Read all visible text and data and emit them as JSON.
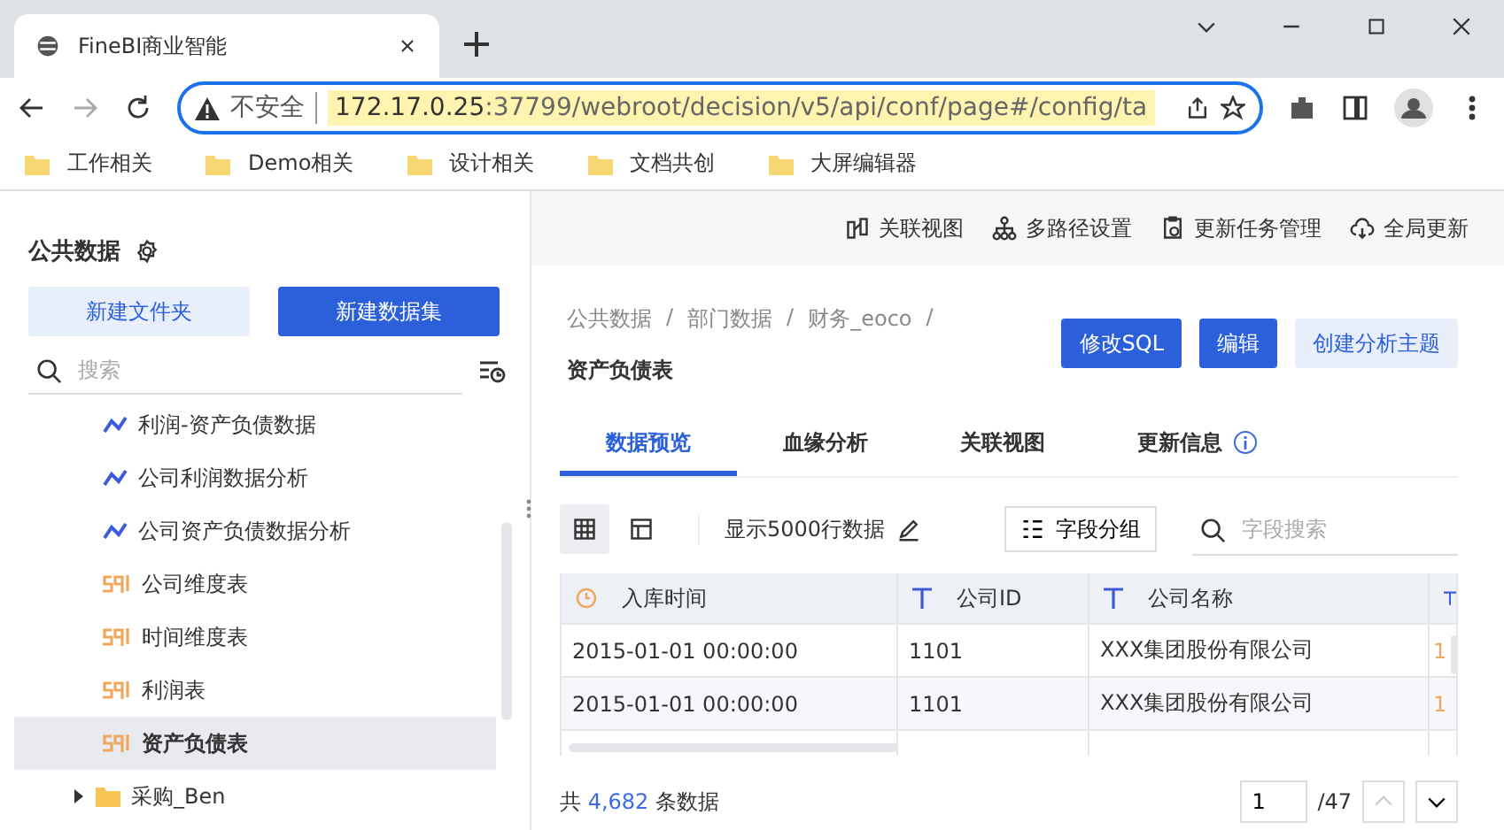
{
  "browser": {
    "tab_title": "FineBI商业智能",
    "security": "不安全",
    "url_host": "172.17.0.25",
    "url_rest": ":37799/webroot/decision/v5/api/conf/page#/config/ta",
    "bookmarks": [
      "工作相关",
      "Demo相关",
      "设计相关",
      "文档共创",
      "大屏编辑器"
    ]
  },
  "sidebar": {
    "title": "公共数据",
    "buttons": [
      {
        "label": "新建文件夹",
        "kind": "secondary"
      },
      {
        "label": "新建数据集",
        "kind": "primary"
      }
    ],
    "search": {
      "placeholder": "搜索"
    },
    "tree": [
      {
        "children": [
          {
            "label": "利润-资产负债数据",
            "kind": "analysis",
            "selected": false
          },
          {
            "label": "公司利润数据分析",
            "kind": "analysis",
            "selected": false
          },
          {
            "label": "公司资产负债数据分析",
            "kind": "analysis",
            "selected": false
          },
          {
            "label": "公司维度表",
            "kind": "sql",
            "selected": false
          },
          {
            "label": "时间维度表",
            "kind": "sql",
            "selected": false
          },
          {
            "label": "利润表",
            "kind": "sql",
            "selected": false
          },
          {
            "label": "资产负债表",
            "kind": "sql",
            "selected": true
          }
        ]
      },
      {
        "label": "采购_Ben",
        "kind": "folder",
        "expanded": false,
        "selected": false
      }
    ]
  },
  "top_actions": [
    {
      "label": "关联视图",
      "kind": "relation"
    },
    {
      "label": "多路径设置",
      "kind": "path"
    },
    {
      "label": "更新任务管理",
      "kind": "task"
    },
    {
      "label": "全局更新",
      "kind": "cloud"
    }
  ],
  "breadcrumb": [
    "公共数据",
    "部门数据",
    "财务_eoco"
  ],
  "dataset_title": "资产负债表",
  "actions": [
    {
      "label": "修改SQL",
      "kind": "primary"
    },
    {
      "label": "编辑",
      "kind": "primary"
    },
    {
      "label": "创建分析主题",
      "kind": "secondary"
    }
  ],
  "tabs": [
    {
      "label": "数据预览",
      "selected": true,
      "info": false
    },
    {
      "label": "血缘分析",
      "selected": false,
      "info": false
    },
    {
      "label": "关联视图",
      "selected": false,
      "info": false
    },
    {
      "label": "更新信息",
      "selected": false,
      "info": true
    }
  ],
  "view_modes": [
    {
      "kind": "grid",
      "selected": true
    },
    {
      "kind": "layout",
      "selected": false
    }
  ],
  "row_limit": "显示5000行数据",
  "field_group": "字段分组",
  "field_search": {
    "placeholder": "字段搜索"
  },
  "breadcrumb_separator": "/",
  "table": {
    "columns": [
      {
        "label": "入库时间",
        "kind": "time"
      },
      {
        "label": "公司ID",
        "kind": "text"
      },
      {
        "label": "公司名称",
        "kind": "text"
      },
      {
        "kind": "text"
      }
    ],
    "rows": [
      [
        "2015-01-01 00:00:00",
        "1101",
        "XXX集团股份有限公司",
        "1"
      ],
      [
        "2015-01-01 00:00:00",
        "1101",
        "XXX集团股份有限公司",
        "1"
      ]
    ]
  },
  "footer": {
    "prefix": "共",
    "count": "4,682",
    "suffix": "条数据",
    "page": "1",
    "total": "/47"
  }
}
